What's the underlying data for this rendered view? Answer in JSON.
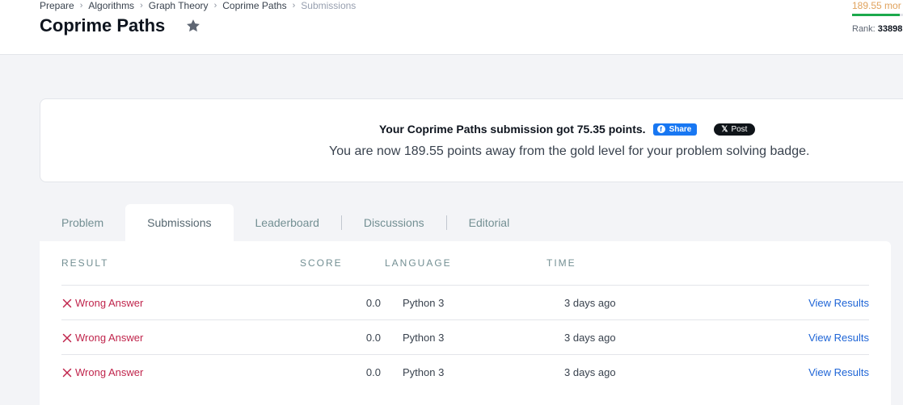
{
  "breadcrumb": [
    "Prepare",
    "Algorithms",
    "Graph Theory",
    "Coprime Paths",
    "Submissions"
  ],
  "page_title": "Coprime Paths",
  "progress": {
    "points_more_label": "189.55 mor",
    "fill_fraction": 0.93,
    "rank_label": "Rank:",
    "rank_value": "33898"
  },
  "banner": {
    "headline": "Your Coprime Paths submission got 75.35 points.",
    "share_label": "Share",
    "post_label": "Post",
    "message": "You are now 189.55 points away from the gold level for your problem solving badge."
  },
  "tabs": [
    {
      "label": "Problem",
      "active": false
    },
    {
      "label": "Submissions",
      "active": true
    },
    {
      "label": "Leaderboard",
      "active": false
    },
    {
      "label": "Discussions",
      "active": false
    },
    {
      "label": "Editorial",
      "active": false
    }
  ],
  "table": {
    "headers": {
      "result": "RESULT",
      "score": "SCORE",
      "language": "LANGUAGE",
      "time": "TIME"
    },
    "rows": [
      {
        "result": "Wrong Answer",
        "score": "0.0",
        "language": "Python 3",
        "time": "3 days ago",
        "action": "View Results"
      },
      {
        "result": "Wrong Answer",
        "score": "0.0",
        "language": "Python 3",
        "time": "3 days ago",
        "action": "View Results"
      },
      {
        "result": "Wrong Answer",
        "score": "0.0",
        "language": "Python 3",
        "time": "3 days ago",
        "action": "View Results"
      }
    ]
  },
  "colors": {
    "error": "#c0254c",
    "link": "#1f65d6",
    "progress": "#1ba94c",
    "points": "#e0a25c"
  }
}
